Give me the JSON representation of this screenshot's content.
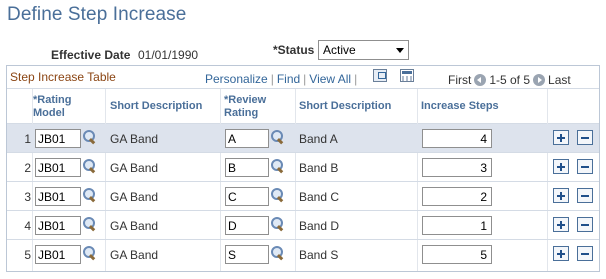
{
  "page": {
    "title": "Define Step Increase"
  },
  "effective_date": {
    "label": "Effective Date",
    "value": "01/01/1990"
  },
  "status": {
    "label": "*Status",
    "value": "Active"
  },
  "grid": {
    "title": "Step Increase Table",
    "links": {
      "personalize": "Personalize",
      "find": "Find",
      "view_all": "View All"
    },
    "pager": {
      "first": "First",
      "range": "1-5 of 5",
      "last": "Last"
    },
    "columns": {
      "rating_model_1": "*Rating",
      "rating_model_2": "Model",
      "short_desc_1": "Short Description",
      "review_rating_1": "*Review",
      "review_rating_2": "Rating",
      "short_desc_2": "Short Description",
      "increase_steps": "Increase Steps"
    },
    "rows": [
      {
        "num": "1",
        "rating_model": "JB01",
        "model_desc": "GA Band",
        "review_rating": "A",
        "rating_desc": "Band A",
        "steps": "4"
      },
      {
        "num": "2",
        "rating_model": "JB01",
        "model_desc": "GA Band",
        "review_rating": "B",
        "rating_desc": "Band B",
        "steps": "3"
      },
      {
        "num": "3",
        "rating_model": "JB01",
        "model_desc": "GA Band",
        "review_rating": "C",
        "rating_desc": "Band C",
        "steps": "2"
      },
      {
        "num": "4",
        "rating_model": "JB01",
        "model_desc": "GA Band",
        "review_rating": "D",
        "rating_desc": "Band D",
        "steps": "1"
      },
      {
        "num": "5",
        "rating_model": "JB01",
        "model_desc": "GA Band",
        "review_rating": "S",
        "rating_desc": "Band S",
        "steps": "5"
      }
    ]
  },
  "icons": {
    "lookup": "magnifier-icon",
    "zoom": "zoom-icon",
    "download": "grid-download-icon",
    "add_row": "plus-icon",
    "delete_row": "minus-icon"
  },
  "colors": {
    "title": "#4a6f99",
    "grid_title": "#8b4513",
    "link": "#33669a",
    "header_text": "#4a6f99",
    "selected_row": "#dde3ed"
  }
}
